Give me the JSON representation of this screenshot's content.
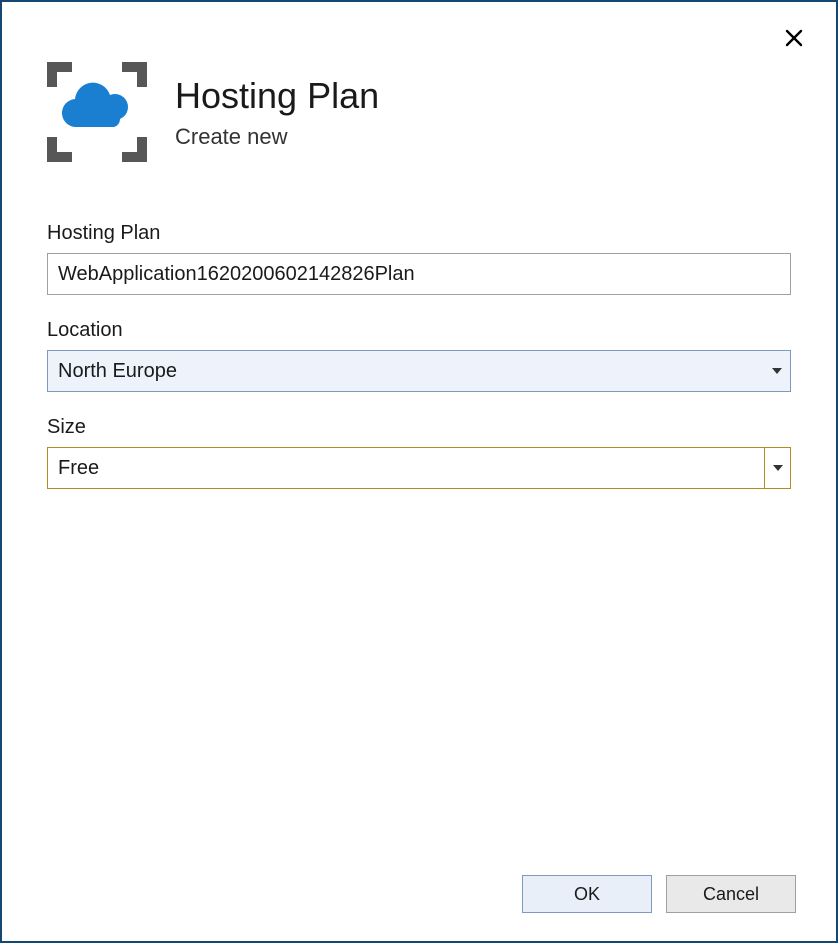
{
  "header": {
    "title": "Hosting Plan",
    "subtitle": "Create new"
  },
  "fields": {
    "hostingPlan": {
      "label": "Hosting Plan",
      "value": "WebApplication1620200602142826Plan"
    },
    "location": {
      "label": "Location",
      "value": "North Europe"
    },
    "size": {
      "label": "Size",
      "value": "Free"
    }
  },
  "buttons": {
    "ok": "OK",
    "cancel": "Cancel"
  }
}
